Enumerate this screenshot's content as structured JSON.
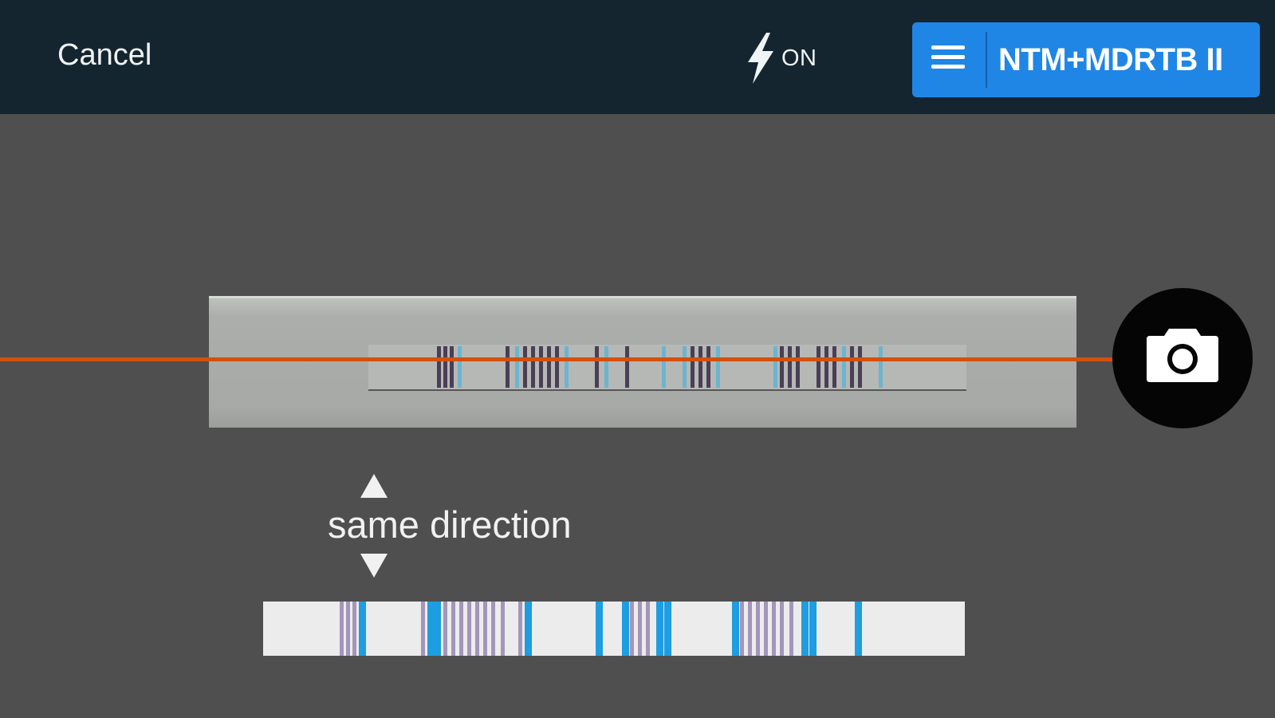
{
  "header": {
    "cancel_label": "Cancel",
    "flash": {
      "icon": "lightning-bolt-icon",
      "label": "ON"
    },
    "kit_selector": {
      "icon": "hamburger-menu-icon",
      "label": "NTM+MDRTB II"
    }
  },
  "scanner": {
    "shutter_icon": "camera-icon",
    "hint": {
      "up_icon": "triangle-up-icon",
      "down_icon": "triangle-down-icon",
      "text": "same direction"
    }
  },
  "colors": {
    "topbar": "#152530",
    "background": "#4f4f4f",
    "accent_blue": "#1f86e6",
    "scan_line": "#d4500b",
    "band_purple": "#a396ba",
    "band_blue": "#1e9de0"
  }
}
